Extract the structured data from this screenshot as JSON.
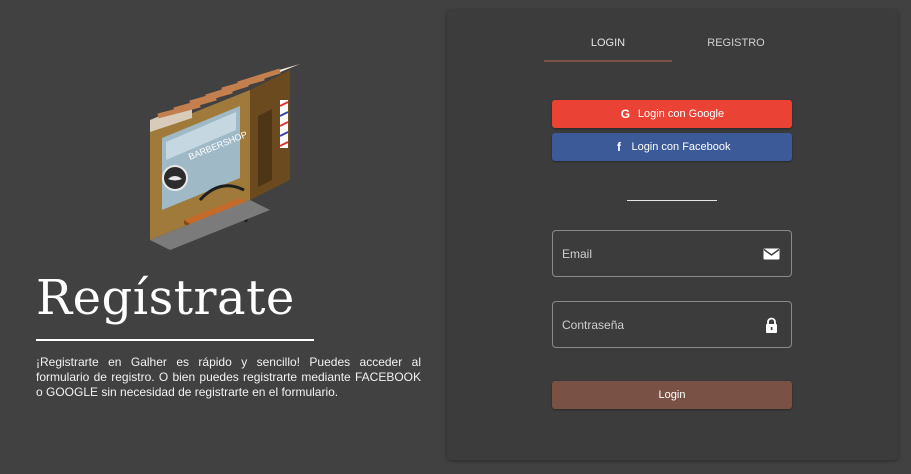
{
  "hero": {
    "title": "Regístrate",
    "description": "¡Registrarte en Galher es rápido y sencillo! Puedes acceder al formulario de registro. O bien puedes registrarte mediante FACEBOOK o GOOGLE sin necesidad de registrarte en el formulario.",
    "illustration_icon": "barbershop-illustration"
  },
  "tabs": [
    {
      "label": "LOGIN",
      "active": true
    },
    {
      "label": "REGISTRO",
      "active": false
    }
  ],
  "social": {
    "google_label": "Login con Google",
    "google_icon": "google-icon",
    "facebook_label": "Login con Facebook",
    "facebook_icon": "facebook-icon"
  },
  "form": {
    "email_placeholder": "Email",
    "email_value": "",
    "email_icon": "envelope-icon",
    "password_placeholder": "Contraseña",
    "password_value": "",
    "password_icon": "lock-icon",
    "submit_label": "Login"
  },
  "colors": {
    "background": "#414141",
    "panel": "#3c3c3c",
    "accent": "#7a5245",
    "google": "#ea4235",
    "facebook": "#3c5a98"
  }
}
